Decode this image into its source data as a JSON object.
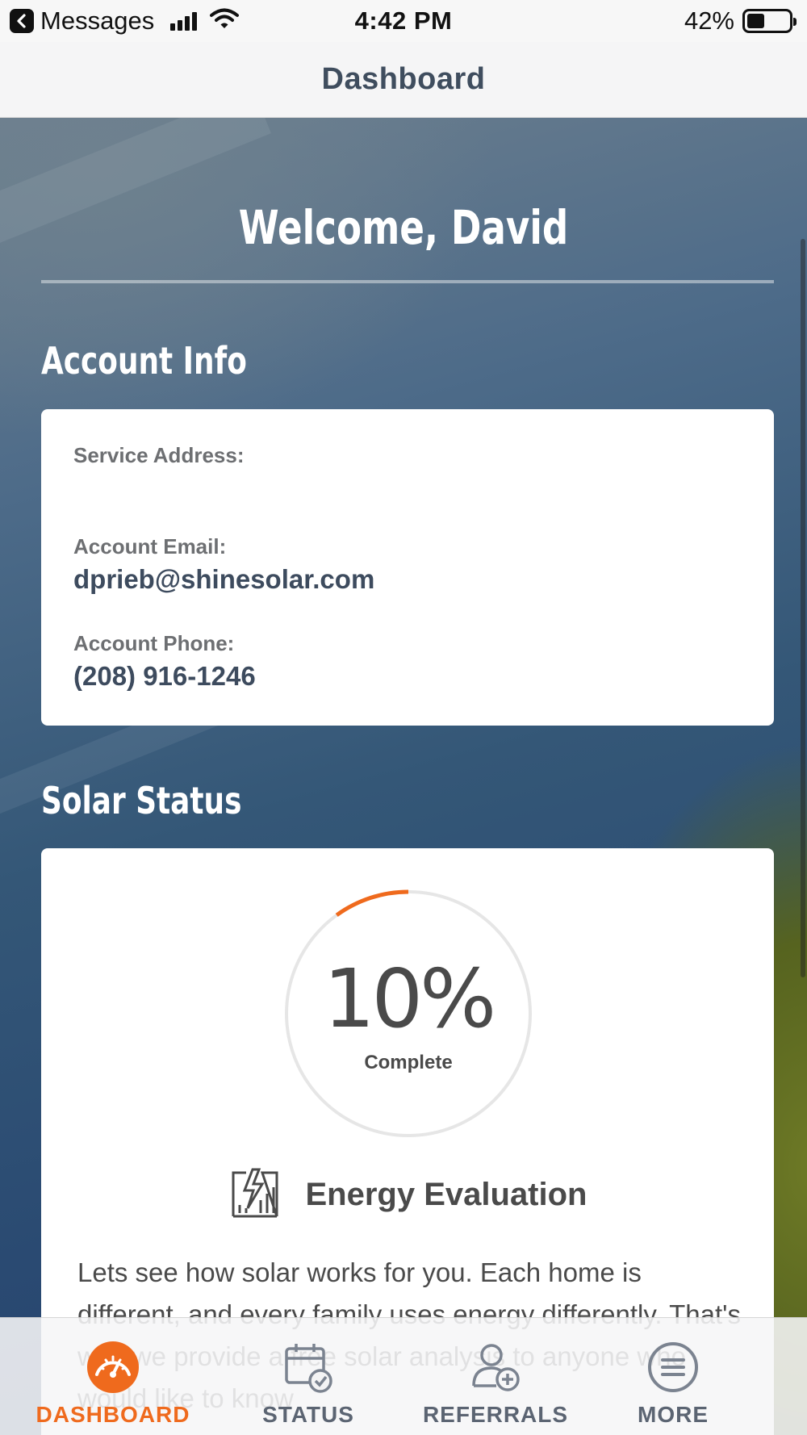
{
  "status_bar": {
    "back_app": "Messages",
    "time": "4:42 PM",
    "battery": "42%",
    "battery_level": 0.42
  },
  "nav": {
    "title": "Dashboard"
  },
  "welcome": "Welcome, David",
  "account_info": {
    "heading": "Account Info",
    "service_address_label": "Service Address:",
    "service_address_value": "",
    "email_label": "Account Email:",
    "email_value": "dprieb@shinesolar.com",
    "phone_label": "Account Phone:",
    "phone_value": "(208) 916-1246"
  },
  "solar_status": {
    "heading": "Solar Status",
    "progress_percent": 10,
    "progress_text": "10%",
    "progress_caption": "Complete",
    "stage_icon": "energy-evaluation-icon",
    "stage_title": "Energy Evaluation",
    "stage_description": "Lets see how solar works for you. Each home is different, and every family uses energy differently. That's why we provide a free solar analysis to anyone who would like to know"
  },
  "colors": {
    "accent": "#ef6a1d",
    "ring_track": "#e6e6e6",
    "text_dark": "#3d4b5e"
  },
  "tabs": [
    {
      "label": "DASHBOARD",
      "icon": "speedometer-icon",
      "active": true
    },
    {
      "label": "STATUS",
      "icon": "calendar-check-icon",
      "active": false
    },
    {
      "label": "REFERRALS",
      "icon": "add-user-icon",
      "active": false
    },
    {
      "label": "MORE",
      "icon": "menu-icon",
      "active": false
    }
  ]
}
